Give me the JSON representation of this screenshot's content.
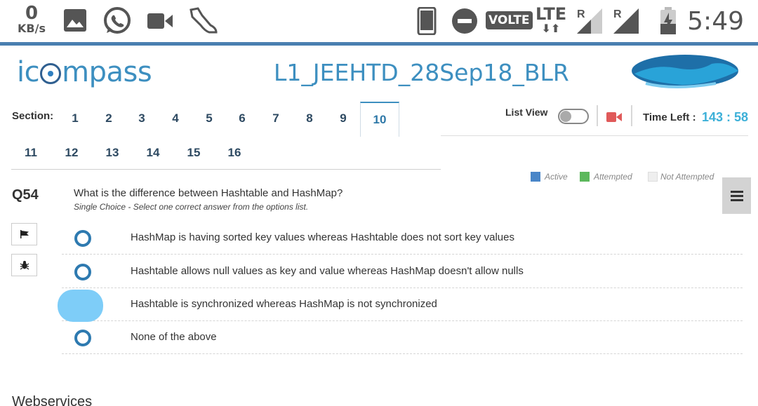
{
  "status_bar": {
    "speed_value": "0",
    "speed_unit": "KB/s",
    "volte": "VOLTE",
    "lte": "LTE",
    "roaming_1": "R",
    "roaming_2": "R",
    "time": "5:49",
    "icons": [
      "image-icon",
      "whatsapp-icon",
      "video-icon",
      "fitness-icon",
      "phone-icon",
      "dnd-icon",
      "signal-icon",
      "battery-icon"
    ]
  },
  "header": {
    "logo_text_before": "ic",
    "logo_text_after": "mpass",
    "exam_title": "L1_JEEHTD_28Sep18_BLR"
  },
  "sections": {
    "label": "Section:",
    "tabs": [
      "1",
      "2",
      "3",
      "4",
      "5",
      "6",
      "7",
      "8",
      "9",
      "10",
      "11",
      "12",
      "13",
      "14",
      "15",
      "16"
    ],
    "active": "10"
  },
  "controls": {
    "list_view_label": "List View",
    "time_left_label": "Time Left :",
    "time_left_value": "143 : 58"
  },
  "legend": {
    "active": "Active",
    "attempted": "Attempted",
    "not_attempted": "Not Attempted",
    "colors": {
      "active": "#4a86c8",
      "attempted": "#5cb85c",
      "not_attempted": "#eeeeee"
    }
  },
  "question": {
    "number": "Q54",
    "text": "What is the difference between Hashtable and HashMap?",
    "type": "Single Choice - Select one correct answer from the options list.",
    "options": [
      "HashMap is having sorted key values whereas Hashtable does not sort key values",
      "Hashtable allows null values as key and value whereas HashMap doesn't allow nulls",
      "Hashtable is synchronized whereas HashMap is not synchronized",
      "None of the above"
    ],
    "selected_index": 2
  },
  "footer": {
    "next_section": "Webservices"
  },
  "colors": {
    "accent": "#3d8fc0",
    "timer": "#3db0d8",
    "radio": "#2e7ab0",
    "selected_highlight": "#7ecdf8"
  }
}
